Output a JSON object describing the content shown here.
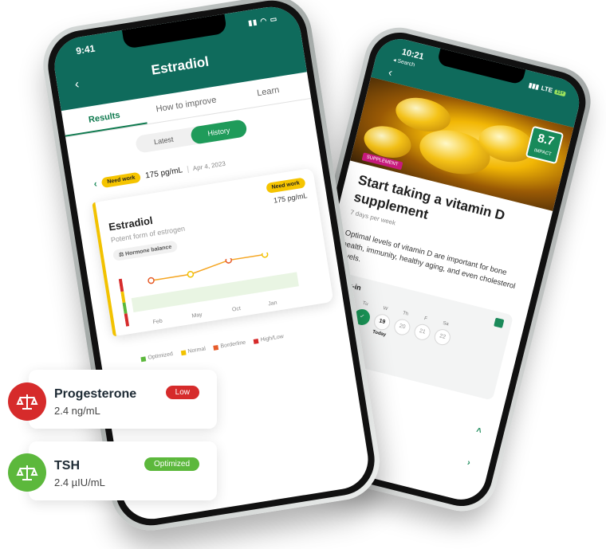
{
  "left_phone": {
    "status_time": "9:41",
    "title": "Estradiol",
    "tabs": [
      "Results",
      "How to improve",
      "Learn"
    ],
    "segment": [
      "Latest",
      "History"
    ],
    "summary": {
      "status": "Need work",
      "value": "175 pg/mL",
      "date": "Apr 4, 2023"
    },
    "card": {
      "title": "Estradiol",
      "subtitle": "Potent form of estrogen",
      "status": "Need work",
      "value": "175 pg/mL",
      "chip": "Hormone balance",
      "months": [
        "Feb",
        "May",
        "Oct",
        "Jan"
      ]
    },
    "legend": [
      "Optimized",
      "Normal",
      "Borderline",
      "High/Low"
    ]
  },
  "right_phone": {
    "status_time": "10:21",
    "status_search": "◂ Search",
    "network": "LTE",
    "battery": "11+",
    "impact_value": "8.7",
    "impact_label": "IMPACT",
    "tag": "SUPPLEMENT",
    "title": "Start taking a vitamin D supplement",
    "frequency": "7 days per week",
    "description": "Optimal levels of vitamin D are important for bone health, immunity, healthy aging, and even cholesterol levels.",
    "checkin_title": "eck-in",
    "days": [
      {
        "letter": "M",
        "num": "",
        "state": "done"
      },
      {
        "letter": "Tu",
        "num": "",
        "state": "done"
      },
      {
        "letter": "W",
        "num": "19",
        "state": "today"
      },
      {
        "letter": "Th",
        "num": "20",
        "state": "future"
      },
      {
        "letter": "F",
        "num": "21",
        "state": "future"
      },
      {
        "letter": "Sa",
        "num": "22",
        "state": "future"
      }
    ],
    "today_label": "Today",
    "section": "blood"
  },
  "cards": [
    {
      "title": "Progesterone",
      "value": "2.4 ng/mL",
      "badge": "Low",
      "color": "#d62b2b"
    },
    {
      "title": "TSH",
      "value": "2.4 µIU/mL",
      "badge": "Optimized",
      "color": "#5cb83c"
    }
  ]
}
